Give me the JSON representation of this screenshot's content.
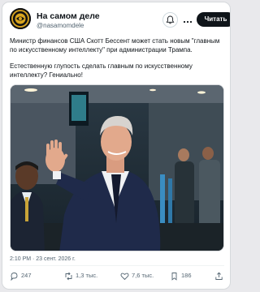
{
  "post": {
    "author_name": "На самом деле",
    "author_handle": "@nasamomdele",
    "follow_label": "Читать",
    "paragraph_1": "Министр финансов США Скотт Бессент может стать новым \"главным по искусственному интеллекту\" при администрации Трампа.",
    "paragraph_2": "Естественную глупость сделать главным по искусственному интеллекту? Гениально!",
    "timestamp": "2:10 PM · 23 сент. 2026 г.",
    "stats": {
      "replies": "247",
      "reposts": "1,3 тыс.",
      "likes": "7,6 тыс.",
      "bookmarks": "186"
    }
  },
  "colors": {
    "text": "#0f1419",
    "secondary": "#536471",
    "follow_bg": "#0f1419",
    "avatar_ring": "#d9a520"
  },
  "icons": {
    "avatar": "avatar-logo",
    "bell": "bell-icon",
    "more": "more-icon",
    "reply": "reply-icon",
    "repost": "repost-icon",
    "like": "heart-icon",
    "bookmark": "bookmark-icon",
    "share": "share-icon"
  }
}
